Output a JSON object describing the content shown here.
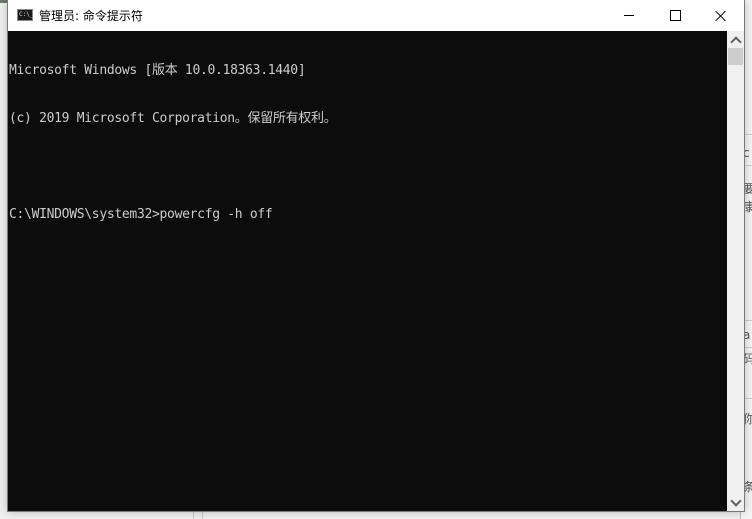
{
  "window": {
    "title": "管理员: 命令提示符",
    "icon": "cmd-icon",
    "controls": {
      "minimize": "minimize-icon",
      "maximize": "maximize-icon",
      "close": "close-icon"
    }
  },
  "console": {
    "lines": [
      "Microsoft Windows [版本 10.0.18363.1440]",
      "(c) 2019 Microsoft Corporation。保留所有权利。",
      "",
      "C:\\WINDOWS\\system32>powercfg -h off"
    ],
    "colors": {
      "background": "#0c0c0c",
      "foreground": "#cccccc"
    }
  },
  "background_window": {
    "partial_glyphs": [
      "c",
      "要",
      "康",
      "a",
      "码",
      "你",
      "条"
    ]
  }
}
